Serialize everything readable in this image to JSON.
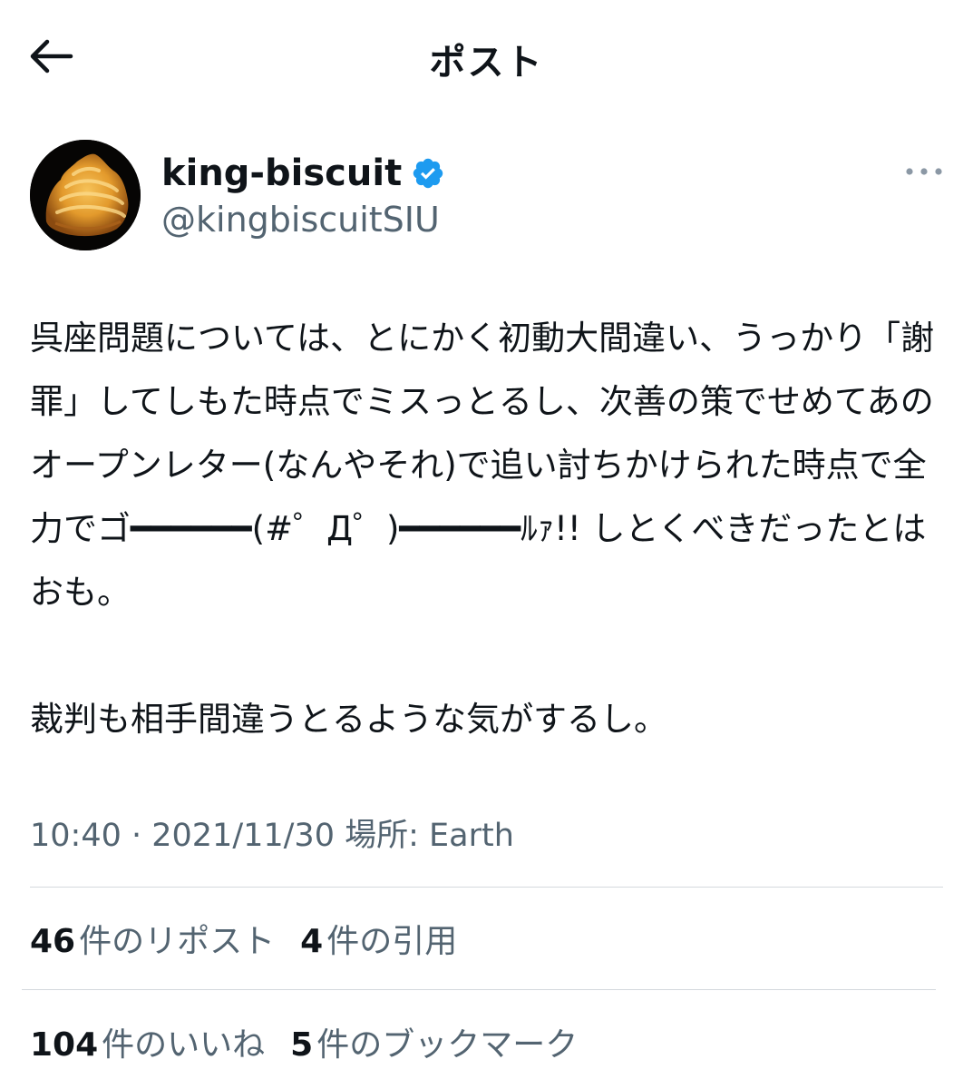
{
  "header": {
    "title": "ポスト",
    "back_icon": "arrow-left-icon"
  },
  "author": {
    "display_name": "king-biscuit",
    "handle": "@kingbiscuitSIU",
    "verified": true,
    "verified_color": "#1d9bf0",
    "avatar_icon": "biscuit-avatar",
    "more_icon": "more-horizontal-icon"
  },
  "tweet": {
    "paragraphs": [
      "呉座問題については、とにかく初動大間違い、うっかり「謝罪」してしもた時点でミスっとるし、次善の策でせめてあのオープンレター(なんやそれ)で追い討ちかけられた時点で全力でゴ━━━━━━(#゜Д゜)━━━━━━ﾙｧ!! しとくべきだったとはおも。",
      "裁判も相手間違うとるような気がするし。"
    ]
  },
  "meta": {
    "time_date": "10:40 · 2021/11/30",
    "location_label": "場所: ",
    "location": "Earth"
  },
  "stats": {
    "retweets": {
      "count": "46",
      "label": "件のリポスト"
    },
    "quotes": {
      "count": "4",
      "label": "件の引用"
    },
    "likes": {
      "count": "104",
      "label": "件のいいね"
    },
    "bookmarks": {
      "count": "5",
      "label": "件のブックマーク"
    }
  },
  "colors": {
    "text_primary": "#0f1419",
    "text_secondary": "#536471",
    "divider": "#d4d9dd",
    "accent": "#1d9bf0"
  }
}
